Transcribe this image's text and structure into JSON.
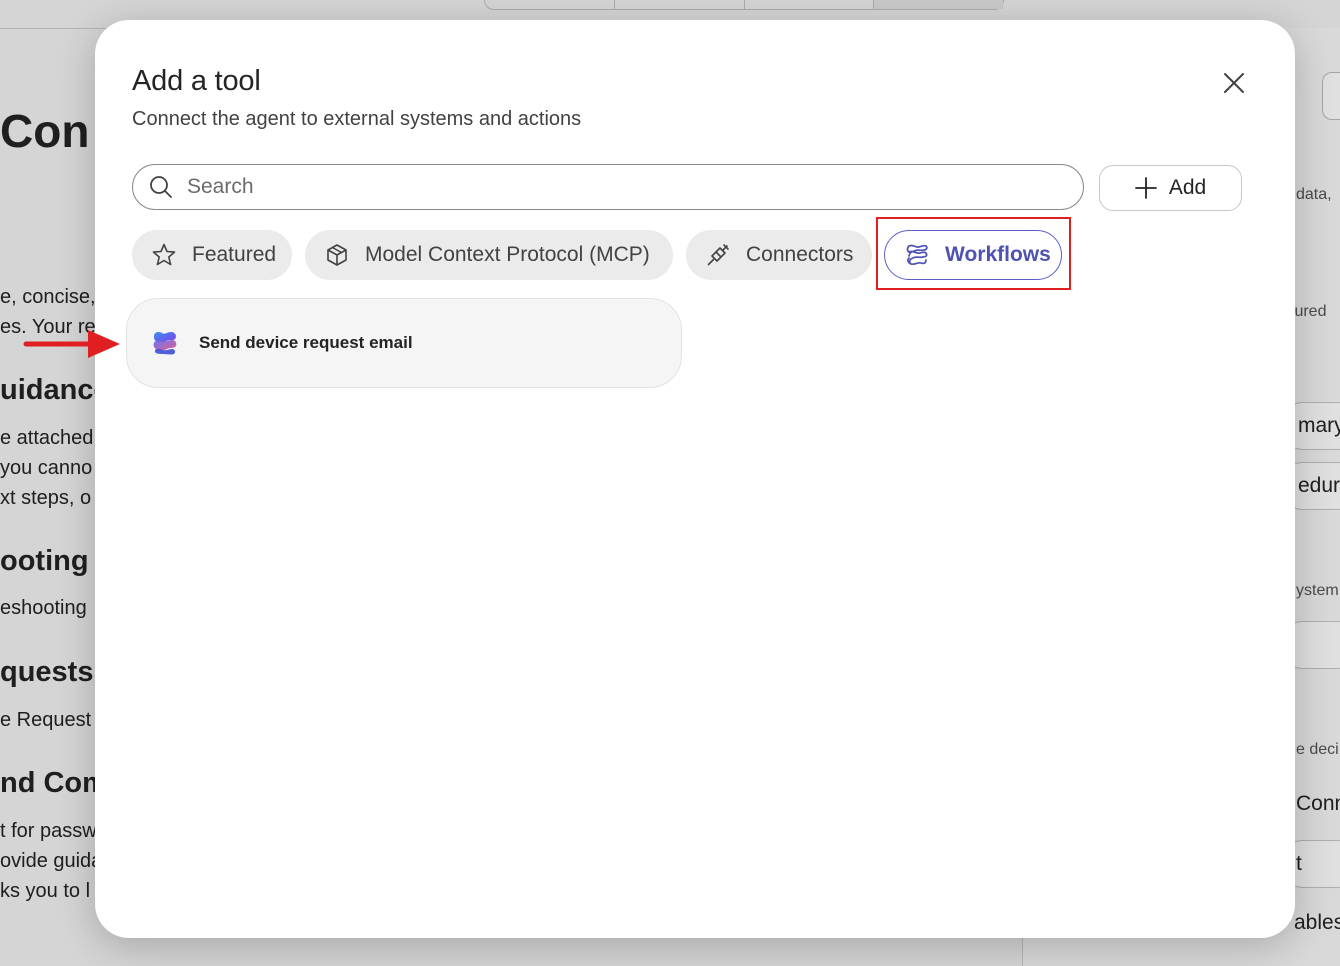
{
  "background": {
    "headings": [
      "Con",
      "uidance",
      "ooting",
      "quests",
      "nd Com"
    ],
    "paragraphs": [
      "e, concise,",
      "es. Your re",
      "e attached",
      "you canno",
      "xt steps, o",
      "eshooting",
      "e Request F",
      "t for passw",
      "ovide guida",
      "ks you to l"
    ],
    "right_panel": [
      "data,",
      "tured",
      "mary",
      "edure",
      "ystem",
      "e deci",
      "Conn",
      "t",
      "ablesh"
    ]
  },
  "dialog": {
    "title": "Add a tool",
    "subtitle": "Connect the agent to external systems and actions",
    "close_icon": "close-icon",
    "search": {
      "placeholder": "Search",
      "value": ""
    },
    "add_button": {
      "label": "Add",
      "icon": "plus-icon"
    },
    "filters": [
      {
        "label": "Featured",
        "icon": "star-icon",
        "selected": false
      },
      {
        "label": "Model Context Protocol (MCP)",
        "icon": "cube-icon",
        "selected": false
      },
      {
        "label": "Connectors",
        "icon": "plug-icon",
        "selected": false
      },
      {
        "label": "Workflows",
        "icon": "workflow-icon",
        "selected": true
      }
    ],
    "tools": [
      {
        "label": "Send device request email",
        "icon": "workflow-logo-icon"
      }
    ]
  },
  "colors": {
    "accent": "#5b5fc7",
    "highlight": "#e02020",
    "arrow": "#e02020"
  }
}
